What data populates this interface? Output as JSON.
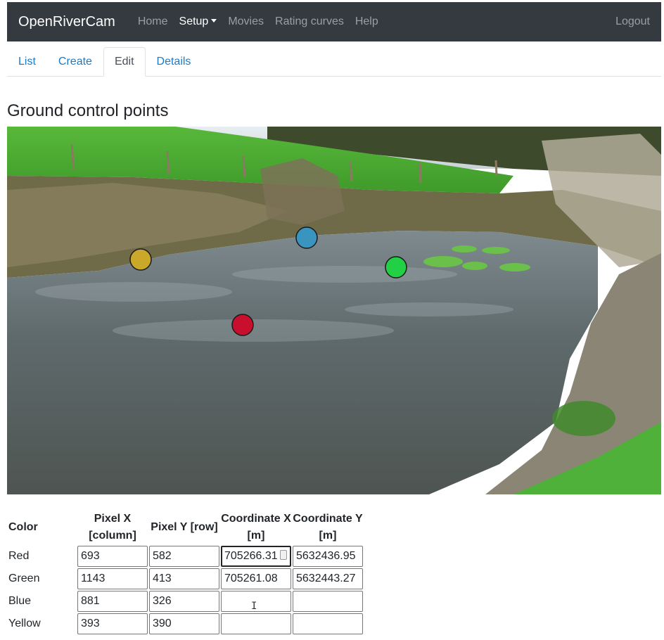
{
  "navbar": {
    "brand": "OpenRiverCam",
    "items": [
      {
        "label": "Home"
      },
      {
        "label": "Setup",
        "active": true
      },
      {
        "label": "Movies"
      },
      {
        "label": "Rating curves"
      },
      {
        "label": "Help"
      }
    ],
    "logout": "Logout",
    "bg_color": "#343a40"
  },
  "tabs": [
    {
      "label": "List"
    },
    {
      "label": "Create"
    },
    {
      "label": "Edit",
      "active": true
    },
    {
      "label": "Details"
    }
  ],
  "page_title": "Ground control points",
  "markers": [
    {
      "name": "Red",
      "color": "#c8102e"
    },
    {
      "name": "Green",
      "color": "#22d045"
    },
    {
      "name": "Blue",
      "color": "#3a94c0"
    },
    {
      "name": "Yellow",
      "color": "#c9a82a"
    }
  ],
  "table": {
    "headers": {
      "color": "Color",
      "pixel_x": [
        "Pixel X",
        "[column]"
      ],
      "pixel_y": "Pixel Y [row]",
      "coord_x": [
        "Coordinate X",
        "[m]"
      ],
      "coord_y": [
        "Coordinate Y",
        "[m]"
      ]
    },
    "rows": [
      {
        "color": "Red",
        "pixel_x": "693",
        "pixel_y": "582",
        "coord_x": "705266.31",
        "coord_y": "5632436.95"
      },
      {
        "color": "Green",
        "pixel_x": "1143",
        "pixel_y": "413",
        "coord_x": "705261.08",
        "coord_y": "5632443.27"
      },
      {
        "color": "Blue",
        "pixel_x": "881",
        "pixel_y": "326",
        "coord_x": "",
        "coord_y": ""
      },
      {
        "color": "Yellow",
        "pixel_x": "393",
        "pixel_y": "390",
        "coord_x": "",
        "coord_y": ""
      }
    ]
  }
}
